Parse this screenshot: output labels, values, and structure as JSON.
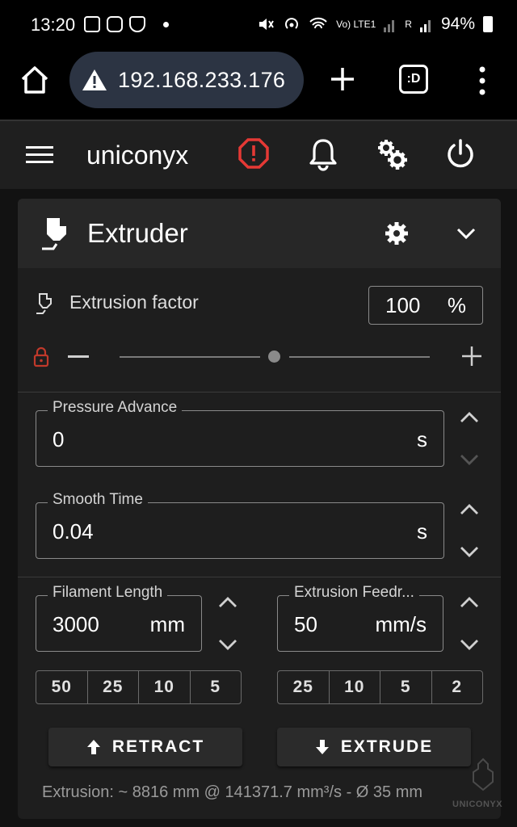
{
  "status_bar": {
    "time": "13:20",
    "network_label": "Vo) LTE1",
    "signal_label": "R",
    "battery": "94%"
  },
  "browser": {
    "url": "192.168.233.176",
    "tabs_label": ":D"
  },
  "app": {
    "title": "uniconyx",
    "alert_color": "#e53935"
  },
  "card": {
    "title": "Extruder",
    "extrusion_factor": {
      "label": "Extrusion factor",
      "value": "100",
      "unit": "%",
      "slider_fraction": 0.5
    },
    "pressure_advance": {
      "label": "Pressure Advance",
      "value": "0",
      "unit": "s"
    },
    "smooth_time": {
      "label": "Smooth Time",
      "value": "0.04",
      "unit": "s"
    },
    "filament_length": {
      "label": "Filament Length",
      "value": "3000",
      "unit": "mm",
      "steps": [
        "50",
        "25",
        "10",
        "5"
      ]
    },
    "extrusion_feedrate": {
      "label": "Extrusion Feedr...",
      "value": "50",
      "unit": "mm/s",
      "steps": [
        "25",
        "10",
        "5",
        "2"
      ]
    },
    "retract_label": "RETRACT",
    "extrude_label": "EXTRUDE",
    "footer": "Extrusion: ~ 8816 mm @ 141371.7 mm³/s - Ø 35 mm"
  },
  "watermark": "UNICONYX"
}
